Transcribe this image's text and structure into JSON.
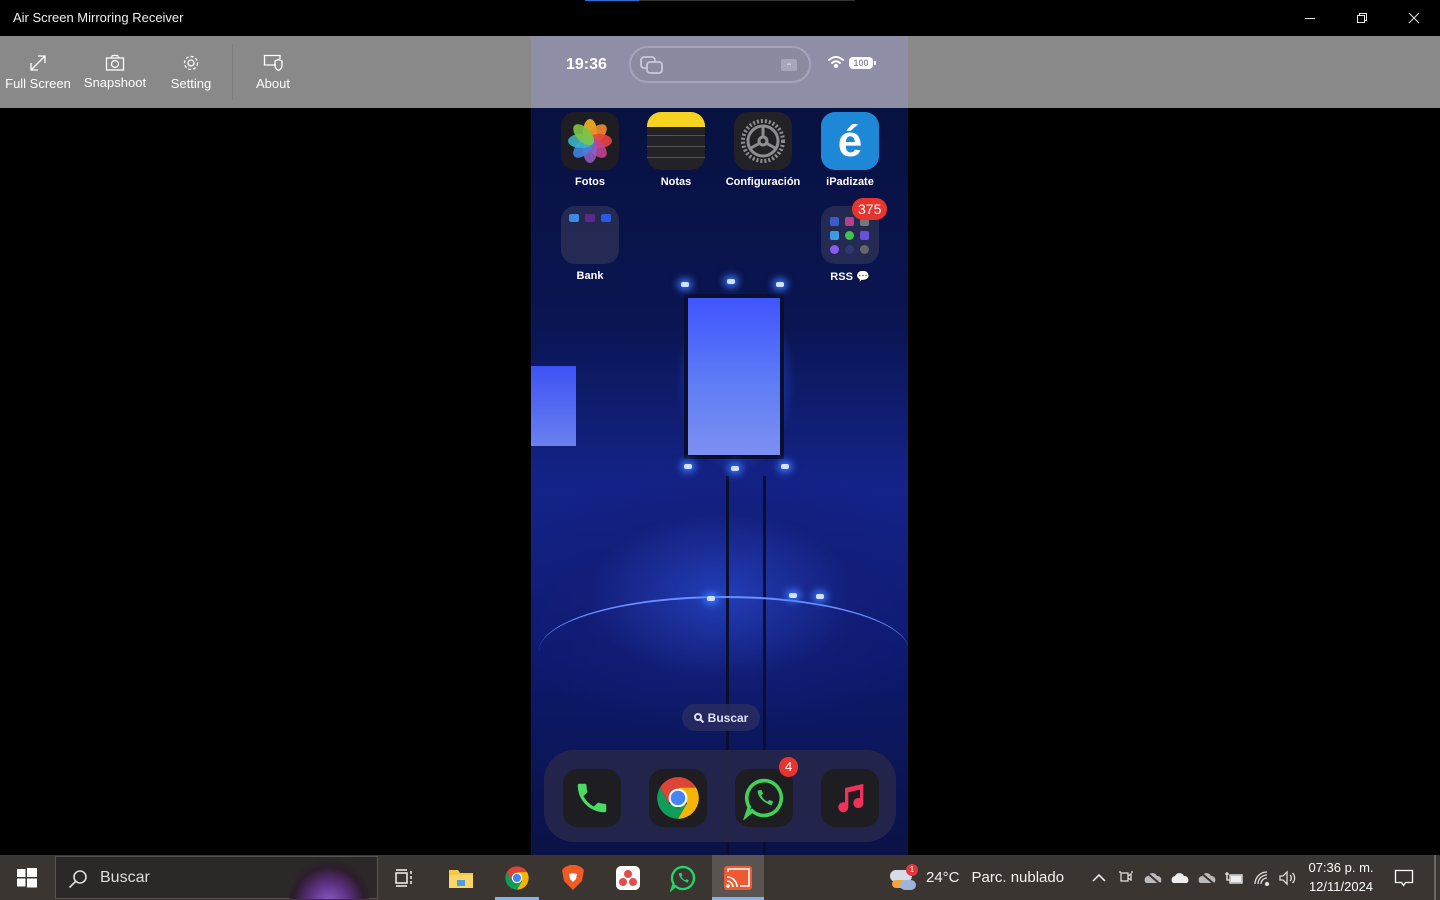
{
  "window": {
    "title": "Air Screen Mirroring Receiver",
    "controls": {
      "minimize": "minimize-icon",
      "restore": "restore-icon",
      "close": "close-icon"
    },
    "connection_progress": 0.2
  },
  "toolbar": {
    "items": [
      {
        "label": "Full Screen",
        "icon": "expand-icon"
      },
      {
        "label": "Snapshoot",
        "icon": "camera-icon"
      },
      {
        "label": "Setting",
        "icon": "gear-icon"
      },
      {
        "label": "About",
        "icon": "monitor-shield-icon"
      }
    ]
  },
  "phone": {
    "status": {
      "time": "19:36",
      "battery": "100",
      "wifi": "wifi-icon"
    },
    "apps": [
      {
        "label": "Fotos",
        "icon": "photos-icon"
      },
      {
        "label": "Notas",
        "icon": "notes-icon"
      },
      {
        "label": "Configuración",
        "icon": "settings-icon"
      },
      {
        "label": "iPadizate",
        "icon": "ipadizate-icon"
      },
      {
        "label": "Bank",
        "icon": "folder-icon"
      },
      {
        "label": "RSS",
        "icon": "folder-icon",
        "badge": "375"
      }
    ],
    "search_label": "Buscar",
    "dock": [
      {
        "name": "Teléfono",
        "icon": "phone-icon"
      },
      {
        "name": "Chrome",
        "icon": "chrome-icon"
      },
      {
        "name": "WhatsApp",
        "icon": "whatsapp-icon",
        "badge": "4"
      },
      {
        "name": "Música",
        "icon": "music-icon"
      }
    ]
  },
  "taskbar": {
    "search_placeholder": "Buscar",
    "pinned": [
      {
        "name": "Task View",
        "icon": "task-view-icon"
      },
      {
        "name": "File Explorer",
        "icon": "folder-icon"
      },
      {
        "name": "Google Chrome",
        "icon": "chrome-icon",
        "running": true
      },
      {
        "name": "Brave",
        "icon": "brave-icon"
      },
      {
        "name": "Asana",
        "icon": "asana-icon"
      },
      {
        "name": "WhatsApp",
        "icon": "whatsapp-icon"
      },
      {
        "name": "Air Screen Mirroring Receiver",
        "icon": "cast-icon",
        "active": true
      }
    ],
    "weather": {
      "temp": "24°C",
      "desc": "Parc. nublado",
      "badge": "1"
    },
    "clock": {
      "time": "07:36 p. m.",
      "date": "12/11/2024"
    }
  }
}
